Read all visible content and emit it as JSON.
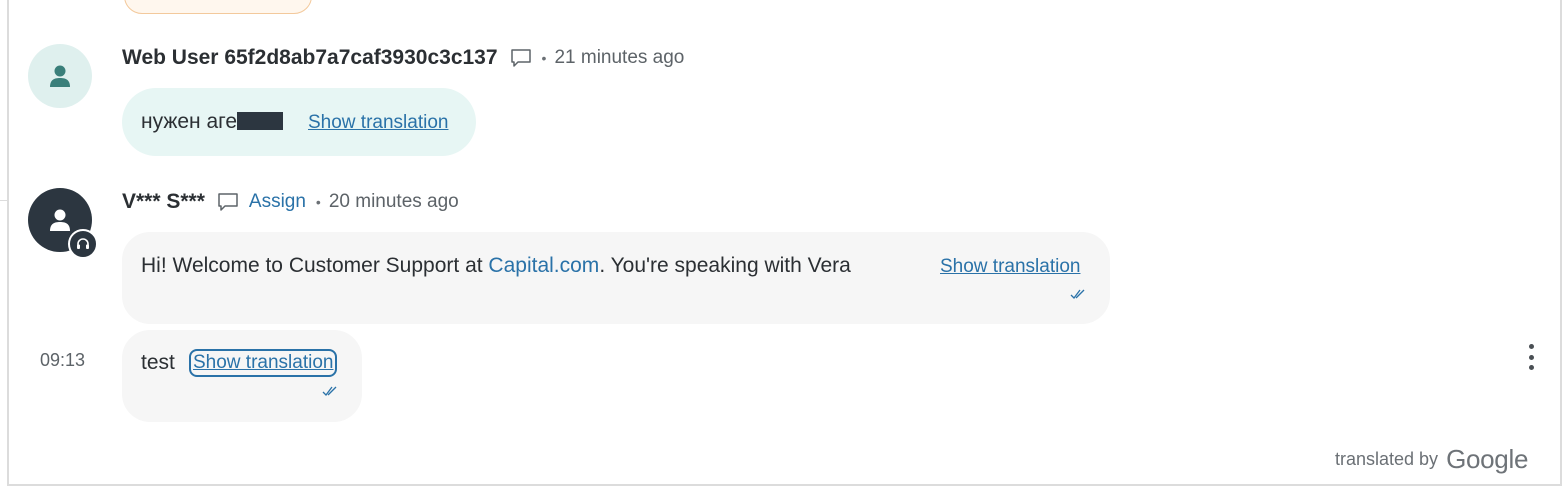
{
  "messages": [
    {
      "author": "Web User 65f2d8ab7a7caf3930c3c137",
      "time": "21 minutes ago",
      "text": "нужен аге",
      "show_translation": "Show translation"
    },
    {
      "author": "V*** S***",
      "assign_label": "Assign",
      "time": "20 minutes ago",
      "text_before": "Hi! Welcome to Customer Support at ",
      "text_link": "Capital.com",
      "text_after": ". You're speaking with Vera",
      "show_translation": "Show translation"
    },
    {
      "timestamp": "09:13",
      "text": "test",
      "show_translation": "Show translation"
    }
  ],
  "footer": {
    "translated_by": "translated by",
    "google": "Google"
  },
  "colors": {
    "link": "#2a72a8",
    "user_bubble": "#e7f6f4",
    "agent_bubble": "#f6f6f6",
    "agent_avatar": "#2c3640",
    "user_avatar": "#dff0ee"
  },
  "icons": [
    "person-icon",
    "headset-icon",
    "comment-icon",
    "double-check-icon",
    "kebab-menu-icon"
  ]
}
